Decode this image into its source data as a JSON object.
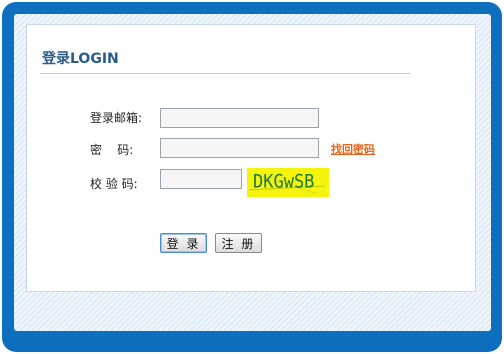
{
  "form": {
    "title": "登录LOGIN",
    "email_label": "登录邮箱:",
    "password_label": "密    码:",
    "captcha_label": "校 验 码:",
    "email_value": "",
    "password_value": "",
    "captcha_value": "",
    "forgot_link": "找回密码",
    "captcha_image_text": "DKGwSB"
  },
  "buttons": {
    "login": "登 录",
    "register": "注 册"
  },
  "colors": {
    "frame_blue": "#0d6fbd",
    "title_blue": "#2a5c8c",
    "link_orange": "#e8641b",
    "captcha_bg": "#f4f40c",
    "captcha_text": "#1e7a3a"
  }
}
